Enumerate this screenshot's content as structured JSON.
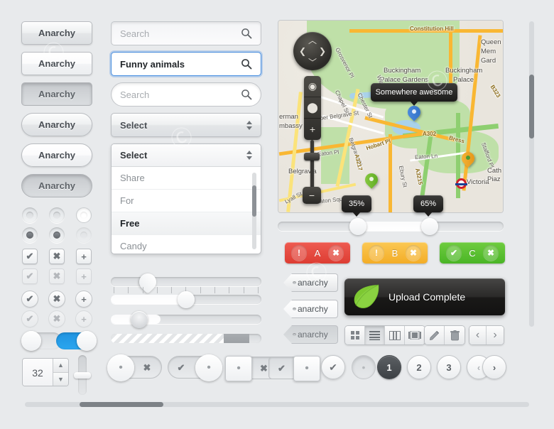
{
  "buttons": [
    {
      "label": "Anarchy",
      "shape": "rect",
      "state": "norm"
    },
    {
      "label": "Anarchy",
      "shape": "rect",
      "state": "hover"
    },
    {
      "label": "Anarchy",
      "shape": "rect",
      "state": "press"
    },
    {
      "label": "Anarchy",
      "shape": "pill",
      "state": "norm"
    },
    {
      "label": "Anarchy",
      "shape": "pill",
      "state": "hover"
    },
    {
      "label": "Anarchy",
      "shape": "pill",
      "state": "press"
    }
  ],
  "controls": {
    "check_icon": "check-mark",
    "close_icon": "cross-mark",
    "plus_icon": "plus-sign",
    "radio_labels": [
      "radio-off",
      "radio-off-hover",
      "radio-light",
      "radio-on",
      "radio-on-hover",
      "radio-disabled"
    ]
  },
  "toggles": [
    {
      "name": "toggle-off",
      "on": false
    },
    {
      "name": "toggle-on",
      "on": true
    }
  ],
  "stepper": {
    "value": "32",
    "up_icon": "chevron-up-icon",
    "down_icon": "chevron-down-icon"
  },
  "fields": [
    {
      "placeholder": "Search",
      "value": "",
      "shape": "rect",
      "state": "norm",
      "icon": "search-icon"
    },
    {
      "placeholder": "Search",
      "value": "Funny animals",
      "shape": "rect",
      "state": "focus",
      "icon": "search-icon"
    },
    {
      "placeholder": "Search",
      "value": "",
      "shape": "pill",
      "state": "norm",
      "icon": "search-icon"
    }
  ],
  "selects": [
    {
      "label": "Select",
      "state": "closed"
    },
    {
      "label": "Select",
      "state": "open"
    }
  ],
  "dropdown": {
    "header": "Select",
    "options": [
      "Share",
      "For",
      "Free",
      "Candy"
    ],
    "selected": "Free"
  },
  "sliders": [
    {
      "name": "pin-slider",
      "value": 27
    },
    {
      "name": "round-slider",
      "value": 47
    },
    {
      "name": "textured-slider",
      "value": 33
    },
    {
      "name": "striped-progress",
      "value": 75,
      "secondary": 57
    }
  ],
  "map": {
    "tooltip": "Somewhere awesome",
    "labels": [
      {
        "text": "Constitution Hill",
        "kind": "road"
      },
      {
        "text": "Queen",
        "kind": "place"
      },
      {
        "text": "Mem",
        "kind": "place"
      },
      {
        "text": "Gard",
        "kind": "place"
      },
      {
        "text": "Buckingham",
        "kind": "place"
      },
      {
        "text": "Palace Gardens",
        "kind": "place"
      },
      {
        "text": "Buckingham",
        "kind": "place"
      },
      {
        "text": "Palace",
        "kind": "place"
      },
      {
        "text": "Grosvenor Pl",
        "kind": "street"
      },
      {
        "text": "Chapel St",
        "kind": "street"
      },
      {
        "text": "Chester St",
        "kind": "street"
      },
      {
        "text": "Wilton St",
        "kind": "street"
      },
      {
        "text": "Upper Belgrave St",
        "kind": "street"
      },
      {
        "text": "Eaton Pl",
        "kind": "street"
      },
      {
        "text": "Belgrave Pl",
        "kind": "street"
      },
      {
        "text": "Belgravia",
        "kind": "place"
      },
      {
        "text": "Hobart Pl",
        "kind": "street"
      },
      {
        "text": "A302",
        "kind": "road"
      },
      {
        "text": "Bress",
        "kind": "road"
      },
      {
        "text": "A3217",
        "kind": "road"
      },
      {
        "text": "A3215",
        "kind": "road"
      },
      {
        "text": "Eaton Ln",
        "kind": "street"
      },
      {
        "text": "Ebury St",
        "kind": "street"
      },
      {
        "text": "Victoria",
        "kind": "station"
      },
      {
        "text": "Lyall St",
        "kind": "street"
      },
      {
        "text": "Eaton Square",
        "kind": "street"
      },
      {
        "text": "Stafford Pl",
        "kind": "street"
      },
      {
        "text": "B323",
        "kind": "road"
      },
      {
        "text": "Cath",
        "kind": "place"
      },
      {
        "text": "Piaz",
        "kind": "place"
      },
      {
        "text": "erman",
        "kind": "place"
      },
      {
        "text": "mbassy",
        "kind": "place"
      }
    ],
    "nav_icon": "direction-pad-icon",
    "zoom_controls": [
      "locate-icon",
      "pin-icon",
      "plus-icon",
      "minus-icon"
    ],
    "range": {
      "low_label": "35%",
      "high_label": "65%",
      "low": 35,
      "high": 65
    }
  },
  "alerts": [
    {
      "label": "A",
      "icon": "exclamation-icon",
      "close_icon": "close-icon",
      "color": "#e8483f"
    },
    {
      "label": "B",
      "icon": "exclamation-icon",
      "close_icon": "close-icon",
      "color": "#f7bb3c"
    },
    {
      "label": "C",
      "icon": "check-icon",
      "close_icon": "close-icon",
      "color": "#5cc134"
    }
  ],
  "tags": [
    {
      "label": "anarchy",
      "state": "norm"
    },
    {
      "label": "anarchy",
      "state": "hover"
    },
    {
      "label": "anarchy",
      "state": "press"
    }
  ],
  "notification": {
    "message": "Upload Complete",
    "icon": "leaf-icon"
  },
  "toolbar": {
    "view_group": [
      {
        "name": "grid-view-icon",
        "active": false
      },
      {
        "name": "list-view-icon",
        "active": true
      },
      {
        "name": "column-view-icon",
        "active": false
      },
      {
        "name": "filmstrip-view-icon",
        "active": false
      }
    ],
    "action_group": [
      {
        "name": "pencil-edit-icon"
      },
      {
        "name": "trash-delete-icon"
      }
    ],
    "nav_group": [
      {
        "name": "prev-arrow-icon",
        "label": "‹"
      },
      {
        "name": "next-arrow-icon",
        "label": "›"
      }
    ]
  },
  "pagination": {
    "pages": [
      "1",
      "2",
      "3"
    ],
    "current": "1",
    "prev_label": "‹",
    "next_label": "›"
  },
  "colors": {
    "background": "#e8eaec",
    "accent_blue": "#2ba6ef",
    "focus_blue": "#4a90e2",
    "alert_red": "#e8483f",
    "alert_yellow": "#f7bb3c",
    "alert_green": "#5cc134",
    "dark_panel": "#1a1918"
  },
  "scrollbars": {
    "vertical": {
      "name": "vertical-scrollbar",
      "thumb_percent": 18
    },
    "horizontal": {
      "name": "horizontal-scrollbar",
      "thumb_percent": 18
    }
  }
}
